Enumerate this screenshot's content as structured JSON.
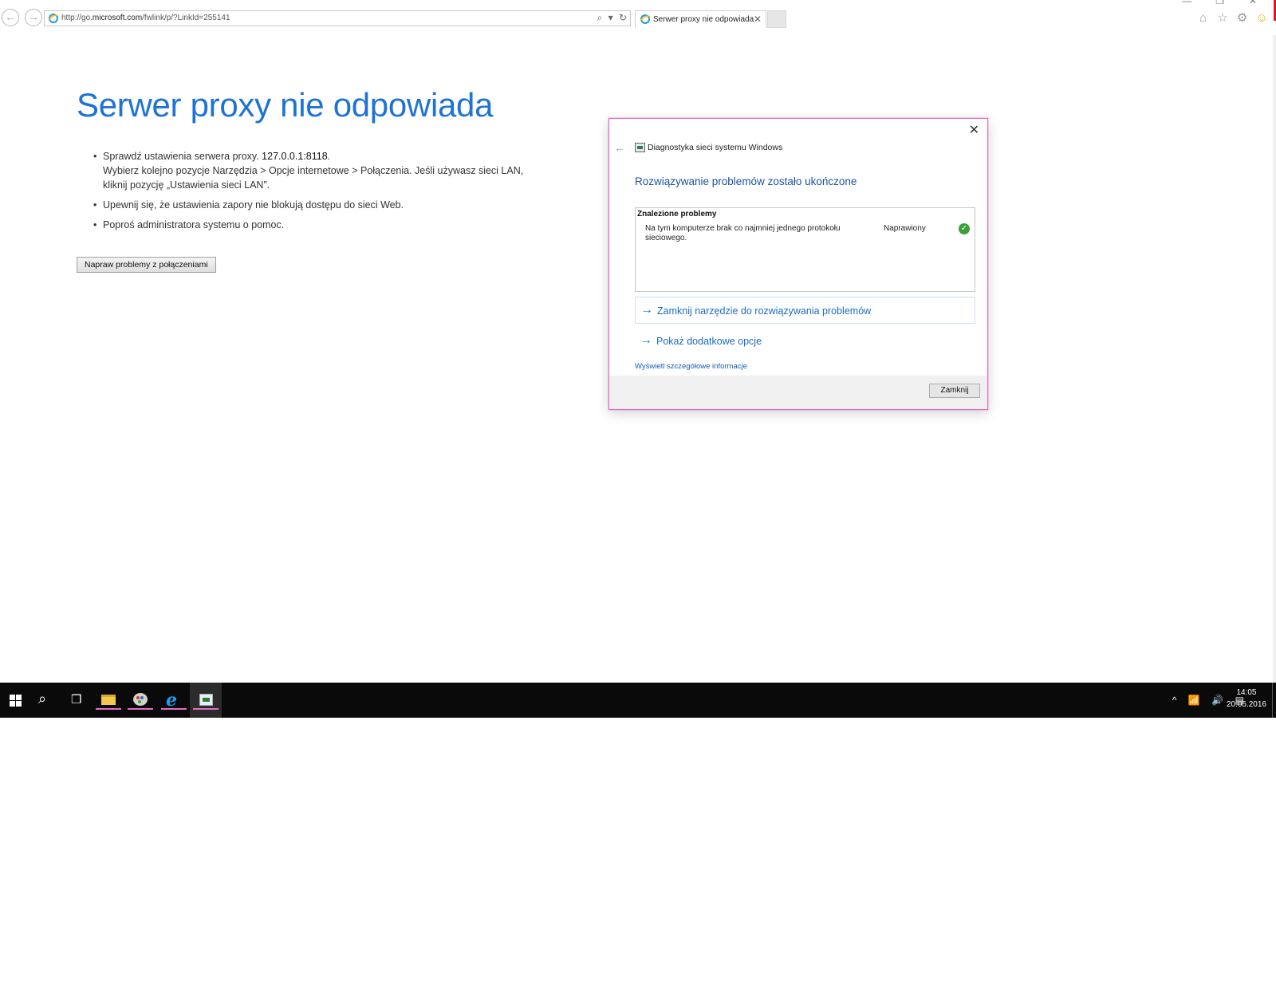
{
  "browser": {
    "back_symbol": "←",
    "forward_symbol": "→",
    "url_prefix": "http://go.",
    "url_domain": "microsoft.com",
    "url_rest": "/fwlink/p/?LinkId=255141",
    "tab_title": "Serwer proxy nie odpowiada",
    "tab_close_symbol": "✕",
    "search_symbol": "⌕",
    "dropdown_symbol": "▾",
    "refresh_symbol": "↻",
    "minimize_symbol": "—",
    "maximize_symbol": "❐",
    "window_close_symbol": "✕",
    "home_symbol": "⌂",
    "favorites_symbol": "☆",
    "settings_symbol": "⚙",
    "feedback_symbol": "☺"
  },
  "page": {
    "title": "Serwer proxy nie odpowiada",
    "bullet1_line1_text": "Sprawdź ustawienia serwera proxy. ",
    "bullet1_proxy": "127.0.0.1:8118",
    "bullet1_period": ".",
    "bullet1_line2": "Wybierz kolejno pozycje Narzędzia > Opcje internetowe > Połączenia. Jeśli używasz sieci LAN, kliknij pozycję „Ustawienia sieci LAN”.",
    "bullet2": "Upewnij się, że ustawienia zapory nie blokują dostępu do sieci Web.",
    "bullet3": "Poproś administratora systemu o pomoc.",
    "fix_button": "Napraw problemy z połączeniami"
  },
  "dialog": {
    "close_symbol": "✕",
    "back_symbol": "←",
    "app_name": "Diagnostyka sieci systemu Windows",
    "heading": "Rozwiązywanie problemów zostało ukończone",
    "problems_title": "Znalezione problemy",
    "problem_text": "Na tym komputerze brak co najmniej jednego protokołu sieciowego.",
    "problem_status": "Naprawiony",
    "check_symbol": "✓",
    "link_arrow": "→",
    "link_close_tool": "Zamknij narzędzie do rozwiązywania problemów",
    "link_more_options": "Pokaż dodatkowe opcje",
    "details_link": "Wyświetl szczegółowe informacje",
    "close_button": "Zamknij"
  },
  "taskbar": {
    "search_symbol": "⌕",
    "taskview_symbol": "❒",
    "ie_symbol": "e",
    "tray_chevron": "^",
    "tray_network": "📶",
    "tray_volume": "🔊",
    "tray_notifications": "▤",
    "time": "14:05",
    "date": "20.05.2016"
  },
  "colors": {
    "title_blue": "#1e73d4",
    "dialog_heading": "#1d51a8",
    "dialog_border": "#e66ac4",
    "taskbar": "#0a0a0a",
    "success_green": "#3aa03a"
  }
}
